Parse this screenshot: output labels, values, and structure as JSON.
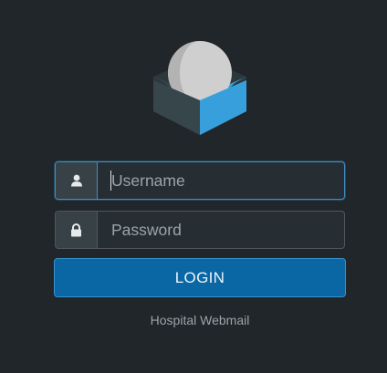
{
  "login": {
    "username_placeholder": "Username",
    "username_value": "",
    "password_placeholder": "Password",
    "password_value": "",
    "submit_label": "LOGIN"
  },
  "footer": {
    "product_name": "Hospital Webmail"
  },
  "icons": {
    "logo": "roundcube-logo-icon",
    "username": "user-icon",
    "password": "lock-icon"
  },
  "colors": {
    "background": "#202629",
    "accent": "#0a67a4",
    "logo_blue": "#37a0dc",
    "logo_dark": "#37464b"
  }
}
